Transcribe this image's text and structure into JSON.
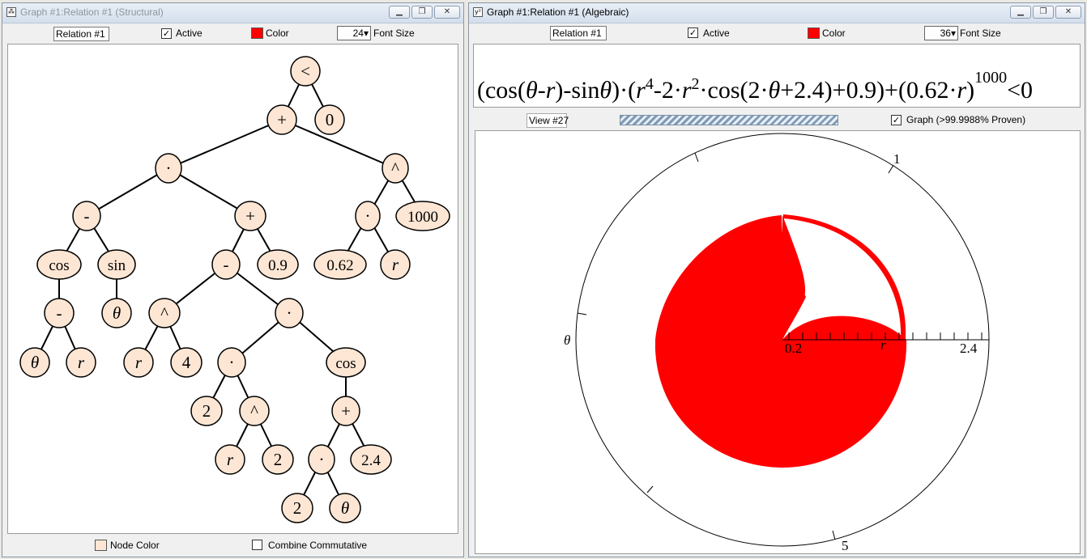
{
  "structural": {
    "title": "Graph #1:Relation #1 (Structural)",
    "relation_name": "Relation #1",
    "active_label": "Active",
    "color_label": "Color",
    "font_size_value": "24",
    "font_size_label": "Font Size",
    "node_color_label": "Node Color",
    "combine_label": "Combine Commutative",
    "node_fill": "#fde6d4",
    "tree": {
      "nodes": [
        {
          "label": "<"
        },
        {
          "label": "+"
        },
        {
          "label": "0"
        },
        {
          "label": "·"
        },
        {
          "label": "^"
        },
        {
          "label": "-"
        },
        {
          "label": "+"
        },
        {
          "label": "·"
        },
        {
          "label": "1000"
        },
        {
          "label": "cos"
        },
        {
          "label": "sin"
        },
        {
          "label": "-"
        },
        {
          "label": "0.9"
        },
        {
          "label": "0.62"
        },
        {
          "label": "r"
        },
        {
          "label": "-"
        },
        {
          "label": "θ"
        },
        {
          "label": "^"
        },
        {
          "label": "·"
        },
        {
          "label": "θ"
        },
        {
          "label": "r"
        },
        {
          "label": "r"
        },
        {
          "label": "4"
        },
        {
          "label": "·"
        },
        {
          "label": "cos"
        },
        {
          "label": "2"
        },
        {
          "label": "^"
        },
        {
          "label": "+"
        },
        {
          "label": "r"
        },
        {
          "label": "2"
        },
        {
          "label": "·"
        },
        {
          "label": "2.4"
        },
        {
          "label": "2"
        },
        {
          "label": "θ"
        }
      ]
    }
  },
  "algebraic": {
    "title": "Graph #1:Relation #1 (Algebraic)",
    "relation_name": "Relation #1",
    "active_label": "Active",
    "color_label": "Color",
    "font_size_value": "36",
    "font_size_label": "Font Size",
    "equation": {
      "parts": [
        "(cos(",
        "θ",
        "-",
        "r",
        ")-sin",
        "θ",
        ")·(",
        "r",
        "4",
        "-2·",
        "r",
        "2",
        "·cos(2·",
        "θ",
        "+2.4)+0.9)+(0.62·",
        "r",
        ")",
        "1000",
        "<0"
      ]
    }
  },
  "graph": {
    "view_label": "View #27",
    "graph_label": "Graph (>99.9988% Proven)",
    "fill_color": "#ff0000",
    "axis_labels": {
      "theta": "θ",
      "r": "r",
      "one": "1",
      "five": "5",
      "r_min": "0.2",
      "r_max": "2.4"
    }
  },
  "icons": {
    "structural_window": "tree-window-icon",
    "algebraic_window": "formula-window-icon"
  },
  "colors": {
    "swatch": "#ff0000",
    "tree_line": "#000000"
  }
}
